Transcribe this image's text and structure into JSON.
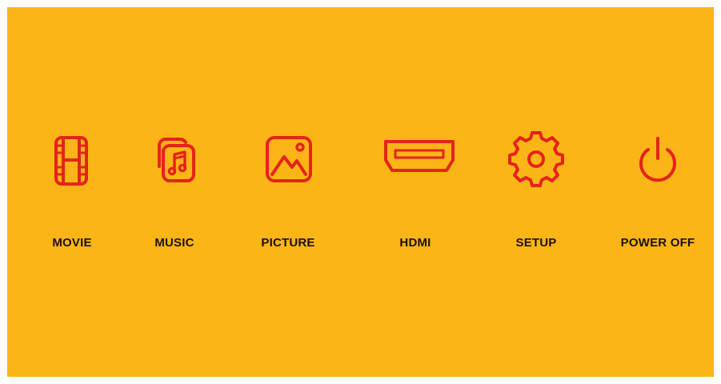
{
  "theme": {
    "background": "#FBB516",
    "icon_color": "#E5231B",
    "label_color": "#1a1208"
  },
  "menu": {
    "items": [
      {
        "label": "MOVIE",
        "icon": "film-strip-icon"
      },
      {
        "label": "MUSIC",
        "icon": "music-note-icon"
      },
      {
        "label": "PICTURE",
        "icon": "picture-icon"
      },
      {
        "label": "HDMI",
        "icon": "hdmi-port-icon"
      },
      {
        "label": "SETUP",
        "icon": "gear-icon"
      },
      {
        "label": "POWER OFF",
        "icon": "power-icon"
      }
    ]
  }
}
